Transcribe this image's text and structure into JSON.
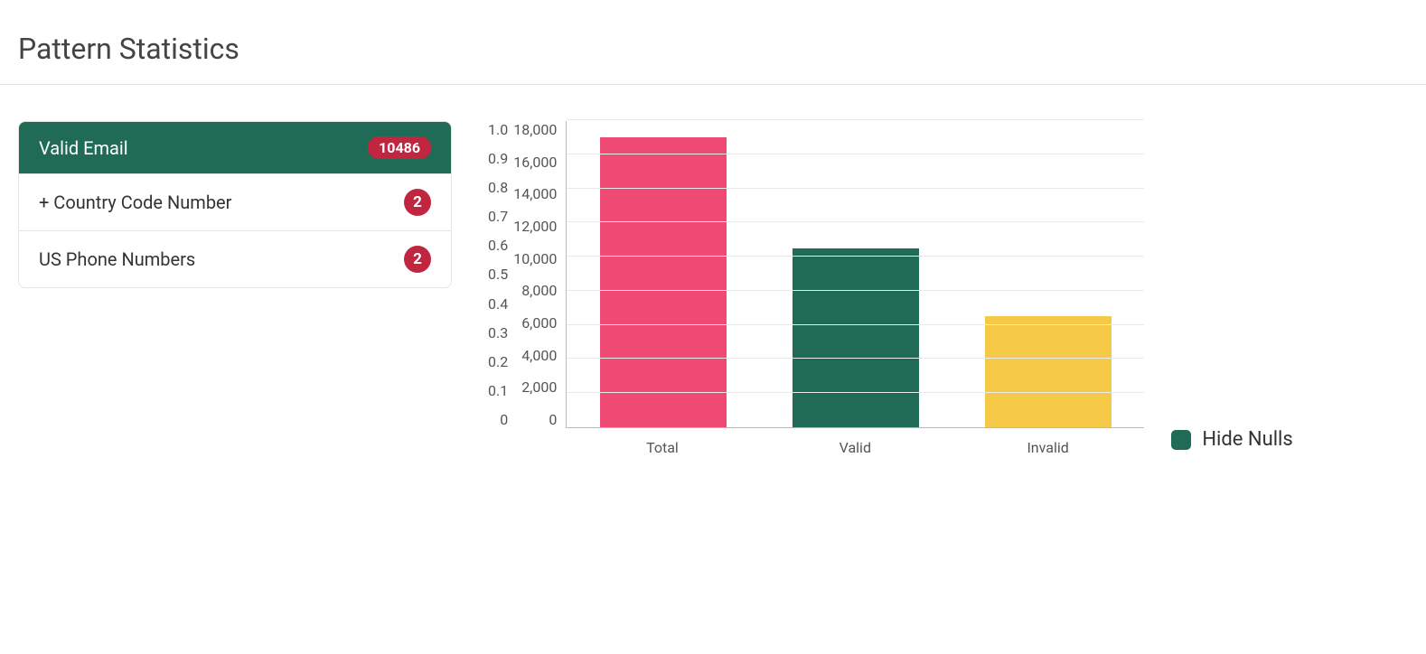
{
  "title": "Pattern Statistics",
  "patterns": {
    "items": [
      {
        "label": "Valid Email",
        "count": "10486",
        "selected": true,
        "badgeStyle": "red-pill"
      },
      {
        "label": "+ Country Code Number",
        "count": "2",
        "selected": false,
        "badgeStyle": "red-circle"
      },
      {
        "label": "US Phone Numbers",
        "count": "2",
        "selected": false,
        "badgeStyle": "red-circle"
      }
    ]
  },
  "legend": {
    "label": "Hide Nulls",
    "swatchColor": "#1f6b56"
  },
  "chart_data": {
    "type": "bar",
    "categories": [
      "Total",
      "Valid",
      "Invalid"
    ],
    "values": [
      17000,
      10486,
      6514
    ],
    "colors": [
      "#ee4a74",
      "#1f6b56",
      "#f6c948"
    ],
    "title": "",
    "xlabel": "",
    "ylabel": "",
    "ylim_left": [
      0,
      1.0
    ],
    "yticks_left": [
      0,
      0.1,
      0.2,
      0.3,
      0.4,
      0.5,
      0.6,
      0.7,
      0.8,
      0.9,
      1.0
    ],
    "ylim_right": [
      0,
      18000
    ],
    "yticks_right": [
      0,
      2000,
      4000,
      6000,
      8000,
      10000,
      12000,
      14000,
      16000,
      18000
    ],
    "yticks_right_labels": [
      "0",
      "2,000",
      "4,000",
      "6,000",
      "8,000",
      "10,000",
      "12,000",
      "14,000",
      "16,000",
      "18,000"
    ]
  }
}
